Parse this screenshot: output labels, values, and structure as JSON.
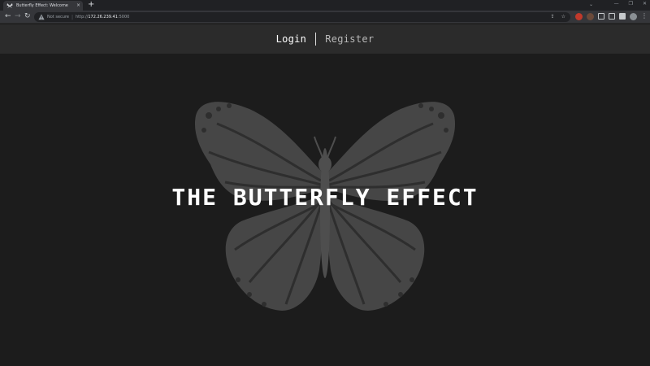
{
  "browser": {
    "tab_title": "Butterfly Effect: Welcome",
    "tab_close_glyph": "×",
    "new_tab_glyph": "+",
    "security_label": "Not secure",
    "url_scheme": "http://",
    "url_host": "172.26.239.41",
    "url_port": ":5000",
    "icons": [
      "back-icon",
      "forward-icon",
      "reload-icon",
      "warning-icon",
      "share-icon",
      "bookmark-star-icon",
      "extensions-icon",
      "menu-icon"
    ]
  },
  "nav": {
    "login_label": "Login",
    "register_label": "Register"
  },
  "hero": {
    "title": "THE BUTTERFLY EFFECT"
  },
  "colors": {
    "page_bg": "#1c1c1c",
    "nav_bg": "#2b2b2b",
    "butterfly": "#464646",
    "title": "#ffffff"
  }
}
